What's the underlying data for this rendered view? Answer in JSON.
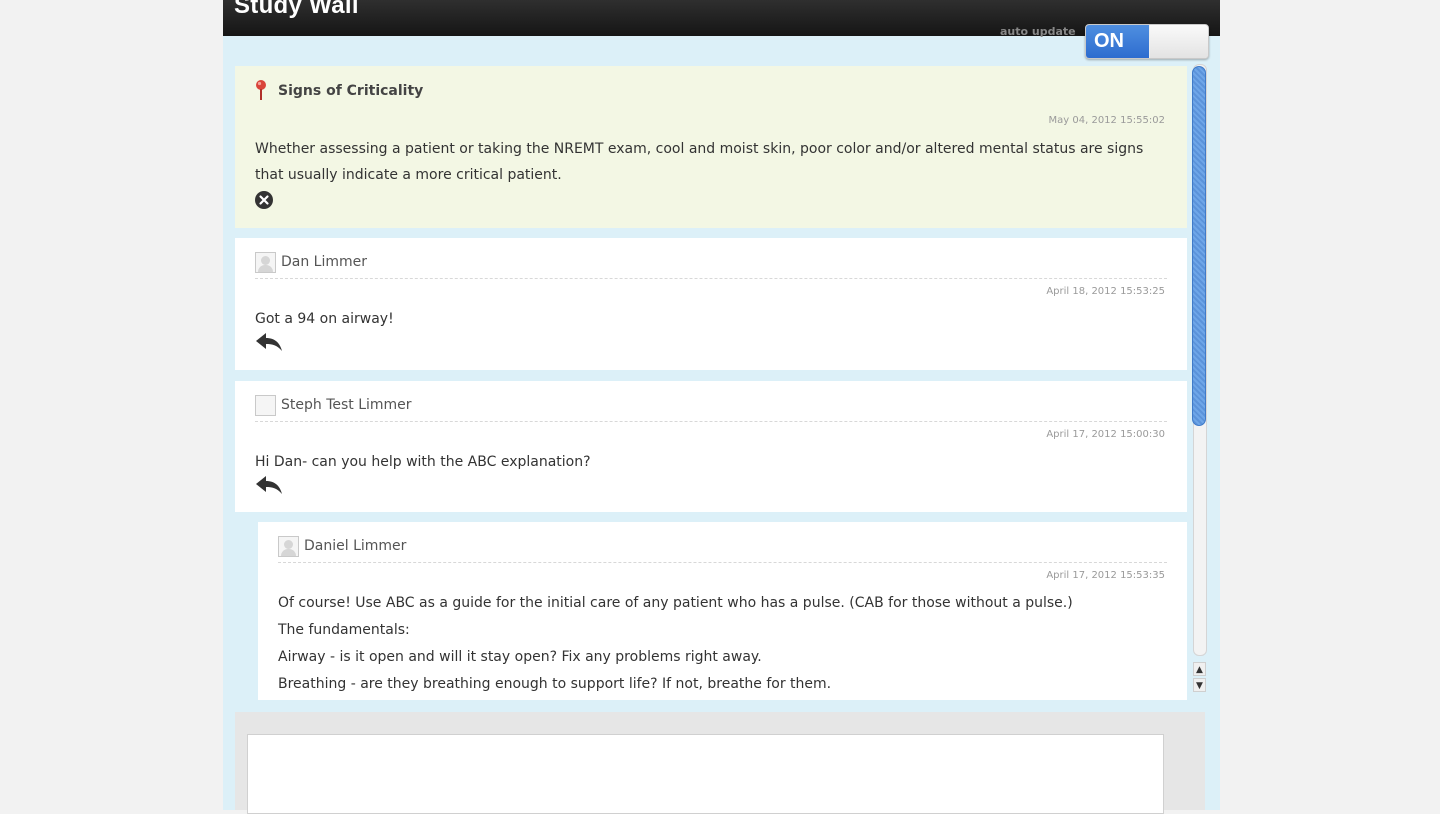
{
  "header": {
    "title": "Study Wall",
    "auto_update_label": "auto update",
    "toggle_on_label": "ON"
  },
  "pinned": {
    "title": "Signs of Criticality",
    "timestamp": "May 04, 2012 15:55:02",
    "body": "Whether assessing a patient or taking the NREMT exam, cool and moist skin, poor color and/or altered mental status are signs that usually indicate a more critical patient."
  },
  "posts": [
    {
      "author": "Dan Limmer",
      "timestamp": "April 18, 2012 15:53:25",
      "body": "Got a 94 on airway!"
    },
    {
      "author": "Steph Test Limmer",
      "timestamp": "April 17, 2012 15:00:30",
      "body": "Hi Dan- can you help with the ABC explanation?"
    }
  ],
  "reply": {
    "author": "Daniel Limmer",
    "timestamp": "April 17, 2012 15:53:35",
    "lines": [
      "Of course! Use ABC as a guide for the initial care of any patient who has a pulse. (CAB for those without a pulse.)",
      "The fundamentals:",
      "Airway - is it open and will it stay open? Fix any problems right away.",
      "Breathing - are they breathing enough to support life? If not, breathe for them."
    ]
  },
  "composer": {
    "placeholder": ""
  },
  "colors": {
    "accent": "#2d6ccf",
    "pinned_bg": "#f3f7e4",
    "app_bg": "#dcf0f8"
  },
  "icons": {
    "pin": "map-pin-icon",
    "close": "close-circle-icon",
    "reply": "reply-arrow-icon",
    "avatar": "user-avatar-icon"
  }
}
